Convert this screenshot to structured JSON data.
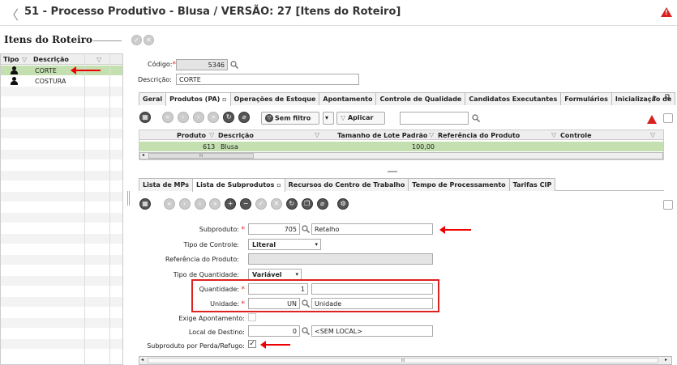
{
  "header": {
    "back": "〈",
    "title": "51 - Processo Produtivo - Blusa / VERSÃO: 27 [Itens do Roteiro]",
    "warning": "!"
  },
  "left": {
    "section_title": "Itens do Roteiro",
    "columns": {
      "tipo": "Tipo",
      "descricao": "Descrição"
    },
    "rows": [
      {
        "label": "CORTE",
        "selected": true
      },
      {
        "label": "COSTURA",
        "selected": false
      }
    ]
  },
  "form": {
    "codigo_label": "Código:",
    "codigo_value": "5346",
    "descricao_label": "Descrição:",
    "descricao_value": "CORTE"
  },
  "tabs_top": [
    "Geral",
    "Produtos (PA)",
    "Operações de Estoque",
    "Apontamento",
    "Controle de Qualidade",
    "Candidatos Executantes",
    "Formulários",
    "Inicialização de"
  ],
  "toolbar_top": {
    "filter_label": "Sem filtro",
    "apply_label": "Aplicar"
  },
  "grid": {
    "headers": [
      "Produto",
      "Descrição",
      "Tamanho de Lote Padrão",
      "Referência do Produto",
      "Controle"
    ],
    "row": {
      "produto": "613",
      "descricao": "Blusa",
      "tamanho": "100,00"
    },
    "scroll_marker": "III"
  },
  "tabs_bottom": [
    "Lista de MPs",
    "Lista de Subprodutos",
    "Recursos do Centro de Trabalho",
    "Tempo de Processamento",
    "Tarifas CIP"
  ],
  "sub": {
    "subproduto_label": "Subproduto:",
    "subproduto_code": "705",
    "subproduto_name": "Retalho",
    "tipo_controle_label": "Tipo de Controle:",
    "tipo_controle_value": "Literal",
    "referencia_label": "Referência do Produto:",
    "tipo_quantidade_label": "Tipo de Quantidade:",
    "tipo_quantidade_value": "Variável",
    "quantidade_label": "Quantidade:",
    "quantidade_value": "1",
    "unidade_label": "Unidade:",
    "unidade_code": "UN",
    "unidade_name": "Unidade",
    "exige_label": "Exige Apontamento:",
    "local_label": "Local de Destino:",
    "local_code": "0",
    "local_name": "<SEM LOCAL>",
    "perda_label": "Subproduto por Perda/Refugo:",
    "scroll_marker": "III"
  }
}
